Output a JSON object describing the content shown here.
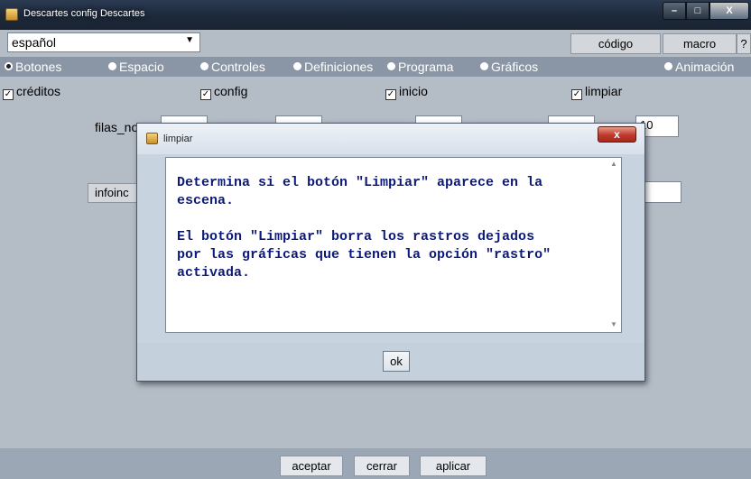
{
  "window": {
    "title": "Descartes config Descartes",
    "controls": [
      "–",
      "□",
      "X"
    ]
  },
  "toolbar": {
    "language": "español",
    "codigo_label": "código",
    "macro_label": "macro",
    "help_label": "?"
  },
  "tabs": [
    {
      "label": "Botones",
      "selected": true
    },
    {
      "label": "Espacio"
    },
    {
      "label": "Controles"
    },
    {
      "label": "Definiciones"
    },
    {
      "label": "Programa"
    },
    {
      "label": "Gráficos"
    },
    {
      "label": "Animación"
    }
  ],
  "checkboxes": [
    {
      "label": "créditos",
      "checked": true
    },
    {
      "label": "config",
      "checked": true
    },
    {
      "label": "inicio",
      "checked": true
    },
    {
      "label": "limpiar",
      "checked": true
    }
  ],
  "background_fields": {
    "filas_label": "filas_no",
    "field_partial": "10",
    "infoinci_label": "infoinc"
  },
  "bottom_buttons": {
    "accept": "aceptar",
    "close": "cerrar",
    "apply": "aplicar"
  },
  "dialog": {
    "title": "limpiar",
    "close_label": "x",
    "text": "Determina si el botón \"Limpiar\" aparece en la\nescena.\n\nEl botón \"Limpiar\" borra los rastros dejados\npor las gráficas que tienen la opción \"rastro\"\nactivada.",
    "ok_label": "ok"
  },
  "colors": {
    "accent_tab_bar": "#8a96a6",
    "dialog_text": "#0b1a78",
    "close_red": "#c0392b"
  }
}
